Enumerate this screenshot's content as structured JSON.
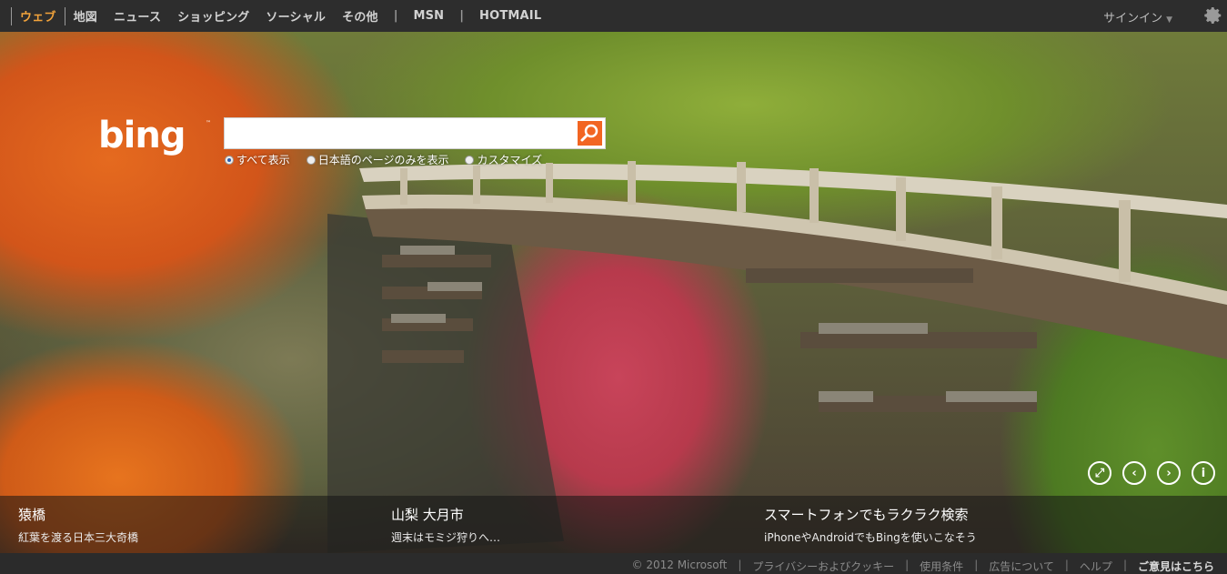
{
  "nav": {
    "items": [
      {
        "label": "ウェブ",
        "active": true
      },
      {
        "label": "地図"
      },
      {
        "label": "ニュース"
      },
      {
        "label": "ショッピング"
      },
      {
        "label": "ソーシャル"
      },
      {
        "label": "その他"
      }
    ],
    "msn": "MSN",
    "hotmail": "HOTMAIL",
    "signin": "サインイン"
  },
  "search": {
    "value": "",
    "options": [
      {
        "label": "すべて表示",
        "selected": true
      },
      {
        "label": "日本語のページのみを表示",
        "selected": false
      },
      {
        "label": "カスタマイズ",
        "selected": false
      }
    ]
  },
  "stories": [
    {
      "title": "猿橋",
      "subtitle": "紅葉を渡る日本三大奇橋"
    },
    {
      "title": "山梨 大月市",
      "subtitle": "週末はモミジ狩りへ…"
    },
    {
      "title": "スマートフォンでもラクラク検索",
      "subtitle": "iPhoneやAndroidでもBingを使いこなそう"
    }
  ],
  "footer": {
    "copyright": "© 2012 Microsoft",
    "links": [
      "プライバシーおよびクッキー",
      "使用条件",
      "広告について",
      "ヘルプ"
    ],
    "feedback": "ご意見はこちら"
  },
  "colors": {
    "accent": "#f26522",
    "nav_active": "#f2a33b"
  },
  "icons": {
    "settings": "gear-icon",
    "search": "magnifier-icon",
    "logo": "bing-logo"
  }
}
